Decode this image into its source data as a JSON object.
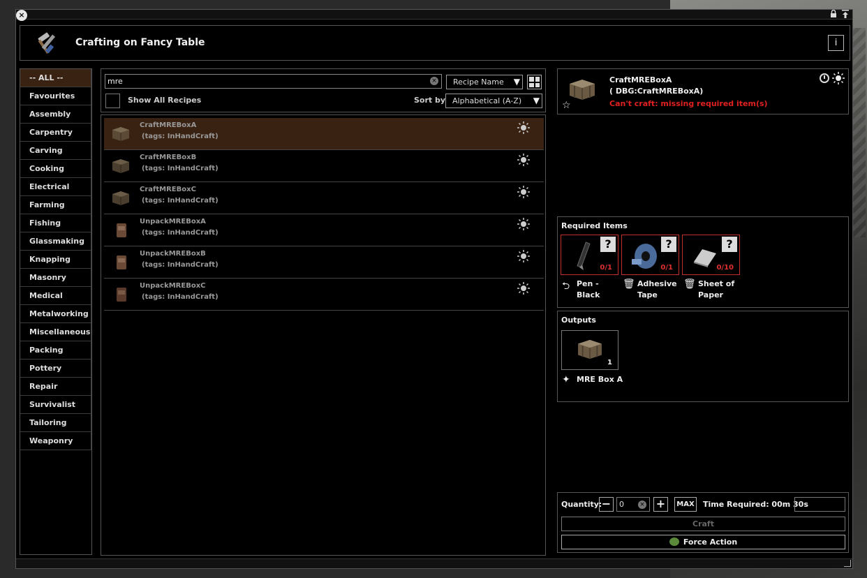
{
  "window": {
    "title": "Crafting on Fancy Table",
    "close_icon": "close-icon",
    "lock_icon": "lock-icon",
    "pin_icon": "pin-icon"
  },
  "categories": [
    "-- ALL --",
    "Favourites",
    "Assembly",
    "Carpentry",
    "Carving",
    "Cooking",
    "Electrical",
    "Farming",
    "Fishing",
    "Glassmaking",
    "Knapping",
    "Masonry",
    "Medical",
    "Metalworking",
    "Miscellaneous",
    "Packing",
    "Pottery",
    "Repair",
    "Survivalist",
    "Tailoring",
    "Weaponry"
  ],
  "search": {
    "value": "mre",
    "filter_mode": "Recipe Name",
    "show_all_label": "Show All Recipes",
    "sort_label": "Sort by:",
    "sort_value": "Alphabetical (A-Z)"
  },
  "recipes": [
    {
      "name": "CraftMREBoxA",
      "tags": "(tags: InHandCraft)",
      "icon": "crate-icon"
    },
    {
      "name": "CraftMREBoxB",
      "tags": "(tags: InHandCraft)",
      "icon": "crate-icon"
    },
    {
      "name": "CraftMREBoxC",
      "tags": "(tags: InHandCraft)",
      "icon": "crate-icon"
    },
    {
      "name": "UnpackMREBoxA",
      "tags": "(tags: InHandCraft)",
      "icon": "mre-pouch-icon"
    },
    {
      "name": "UnpackMREBoxB",
      "tags": "(tags: InHandCraft)",
      "icon": "mre-pouch-icon"
    },
    {
      "name": "UnpackMREBoxC",
      "tags": "(tags: InHandCraft)",
      "icon": "mre-pouch-icon"
    }
  ],
  "detail": {
    "name": "CraftMREBoxA",
    "id": "( DBG:CraftMREBoxA)",
    "error": "Can't craft: missing required item(s)"
  },
  "required": {
    "title": "Required Items",
    "items": [
      {
        "count": "0/1",
        "label": "Pen - Black",
        "action_icon": "return-icon"
      },
      {
        "count": "0/1",
        "label": "Adhesive Tape",
        "action_icon": "trash-icon"
      },
      {
        "count": "0/10",
        "label": "Sheet of Paper",
        "action_icon": "trash-icon"
      }
    ]
  },
  "outputs": {
    "title": "Outputs",
    "count": "1",
    "label": "MRE Box A"
  },
  "controls": {
    "quantity_label": "Quantity:",
    "quantity_value": "0",
    "max_label": "MAX",
    "time_label": "Time Required: 00m 30s",
    "craft_label": "Craft",
    "force_label": "Force Action"
  },
  "colors": {
    "selected_row": "#3a2212",
    "error": "#e02020",
    "slot_border": "#c03030"
  }
}
